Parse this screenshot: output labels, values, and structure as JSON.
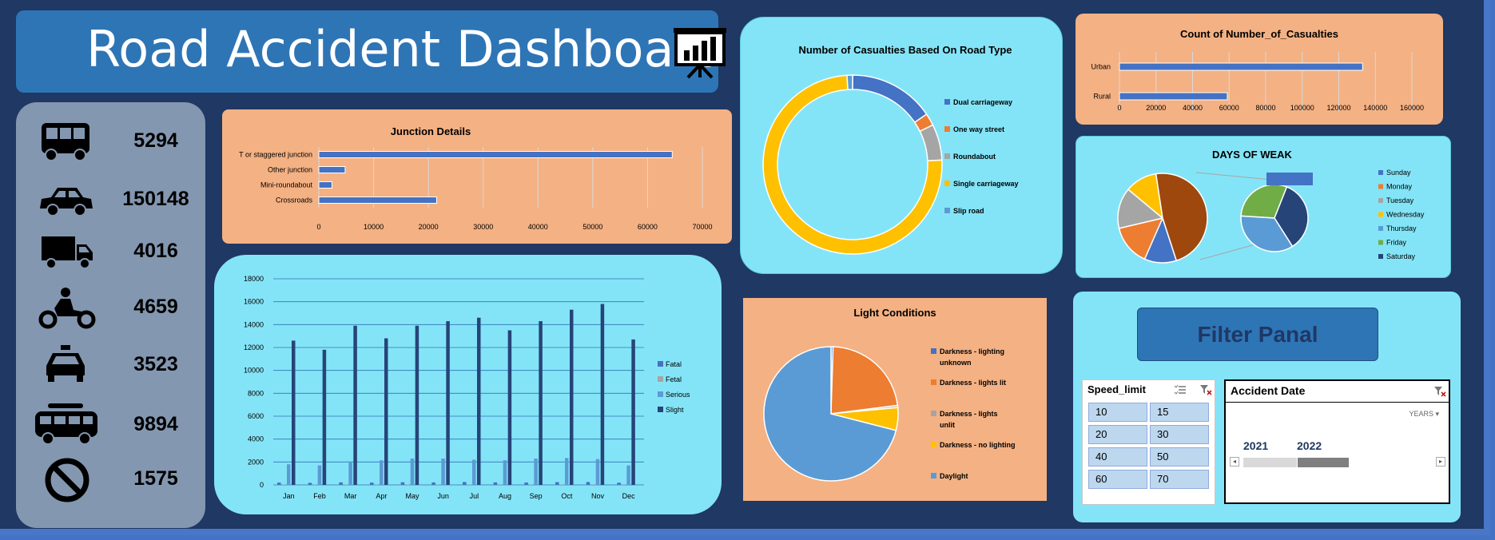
{
  "header": {
    "title": "Road Accident Dashboard",
    "icon": "presentation-chart-icon"
  },
  "kpis": [
    {
      "icon": "bus-icon",
      "value": "5294"
    },
    {
      "icon": "car-icon",
      "value": "150148"
    },
    {
      "icon": "truck-icon",
      "value": "4016"
    },
    {
      "icon": "motorcycle-icon",
      "value": "4659"
    },
    {
      "icon": "taxi-icon",
      "value": "3523"
    },
    {
      "icon": "van-icon",
      "value": "9894"
    },
    {
      "icon": "prohibited-icon",
      "value": "1575"
    }
  ],
  "junction": {
    "chart_data": {
      "type": "bar",
      "title": "Junction Details",
      "categories": [
        "T or staggered junction",
        "Other junction",
        "Mini-roundabout",
        "Crossroads"
      ],
      "values": [
        64500,
        4800,
        2400,
        21500
      ],
      "xlim": [
        0,
        70000
      ],
      "ticks": [
        "0",
        "10000",
        "20000",
        "30000",
        "40000",
        "50000",
        "60000",
        "70000"
      ],
      "color": "#4472c4",
      "grid": true
    }
  },
  "monthly": {
    "chart_data": {
      "type": "bar",
      "title": "",
      "categories": [
        "Jan",
        "Feb",
        "Mar",
        "Apr",
        "May",
        "Jun",
        "Jul",
        "Aug",
        "Sep",
        "Oct",
        "Nov",
        "Dec"
      ],
      "ylim": [
        0,
        18000
      ],
      "ticks": [
        "0",
        "2000",
        "4000",
        "6000",
        "8000",
        "10000",
        "12000",
        "14000",
        "16000",
        "18000"
      ],
      "legend_position": "right",
      "series": [
        {
          "name": "Fatal",
          "color": "#4472c4",
          "values": [
            200,
            180,
            220,
            200,
            230,
            210,
            250,
            220,
            210,
            240,
            250,
            190
          ]
        },
        {
          "name": "Fetal",
          "color": "#a5a5a5",
          "values": [
            30,
            30,
            35,
            30,
            35,
            30,
            35,
            30,
            30,
            35,
            35,
            30
          ]
        },
        {
          "name": "Serious",
          "color": "#5b9bd5",
          "values": [
            1800,
            1700,
            2050,
            2150,
            2300,
            2300,
            2200,
            2150,
            2300,
            2350,
            2250,
            1700
          ]
        },
        {
          "name": "Slight",
          "color": "#264478",
          "values": [
            12600,
            11800,
            13900,
            12800,
            13900,
            14300,
            14600,
            13500,
            14300,
            15300,
            15800,
            12700
          ]
        }
      ]
    }
  },
  "roadtype": {
    "chart_data": {
      "type": "pie",
      "donut": true,
      "title": "Number of Casualties Based On Road Type",
      "legend_position": "right",
      "labels": [
        "Dual carriageway",
        "One way street",
        "Roundabout",
        "Single carriageway",
        "Slip road"
      ],
      "values": [
        15.5,
        2.2,
        6.5,
        74.8,
        1.0
      ],
      "colors": [
        "#4472c4",
        "#ed7d31",
        "#a5a5a5",
        "#ffc000",
        "#5b9bd5"
      ]
    }
  },
  "light": {
    "chart_data": {
      "type": "pie",
      "title": "Light Conditions",
      "legend_position": "right",
      "labels": [
        "Darkness - lighting unknown",
        "Darkness - lights lit",
        "Darkness - lights unlit",
        "Darkness - no lighting",
        "Daylight"
      ],
      "values": [
        0.5,
        22.5,
        0.5,
        5.5,
        71
      ],
      "colors": [
        "#4472c4",
        "#ed7d31",
        "#a5a5a5",
        "#ffc000",
        "#5b9bd5"
      ]
    }
  },
  "count": {
    "chart_data": {
      "type": "bar",
      "title": "Count of Number_of_Casualties",
      "categories": [
        "Urban",
        "Rural"
      ],
      "values": [
        133000,
        59000
      ],
      "xlim": [
        0,
        160000
      ],
      "ticks": [
        "0",
        "20000",
        "40000",
        "60000",
        "80000",
        "100000",
        "120000",
        "140000",
        "160000"
      ],
      "color": "#4472c4",
      "grid": true
    }
  },
  "days": {
    "chart_data": {
      "type": "pie",
      "title": "DAYS OF WEAK",
      "subtype": "pie-of-pie",
      "legend_position": "right",
      "labels": [
        "Sunday",
        "Monday",
        "Tuesday",
        "Wednesday",
        "Thursday",
        "Friday",
        "Saturday"
      ],
      "main_values": [
        11,
        14,
        14,
        11,
        45
      ],
      "main_colors": [
        "#4472c4",
        "#ed7d31",
        "#a5a5a5",
        "#ffc000",
        "#9e480e"
      ],
      "secondary_values": [
        30,
        35,
        35
      ],
      "secondary_colors": [
        "#70ad47",
        "#264478",
        "#5b9bd5"
      ],
      "legend_colors": [
        "#4472c4",
        "#ed7d31",
        "#a5a5a5",
        "#ffc000",
        "#5b9bd5",
        "#70ad47",
        "#264478"
      ]
    }
  },
  "filter": {
    "title": "Filter Panal",
    "speed_limit": {
      "title": "Speed_limit",
      "options": [
        "10",
        "15",
        "20",
        "30",
        "40",
        "50",
        "60",
        "70"
      ]
    },
    "accident_date": {
      "title": "Accident Date",
      "level": "YEARS",
      "years": [
        "2021",
        "2022"
      ],
      "selected": "2022"
    }
  }
}
